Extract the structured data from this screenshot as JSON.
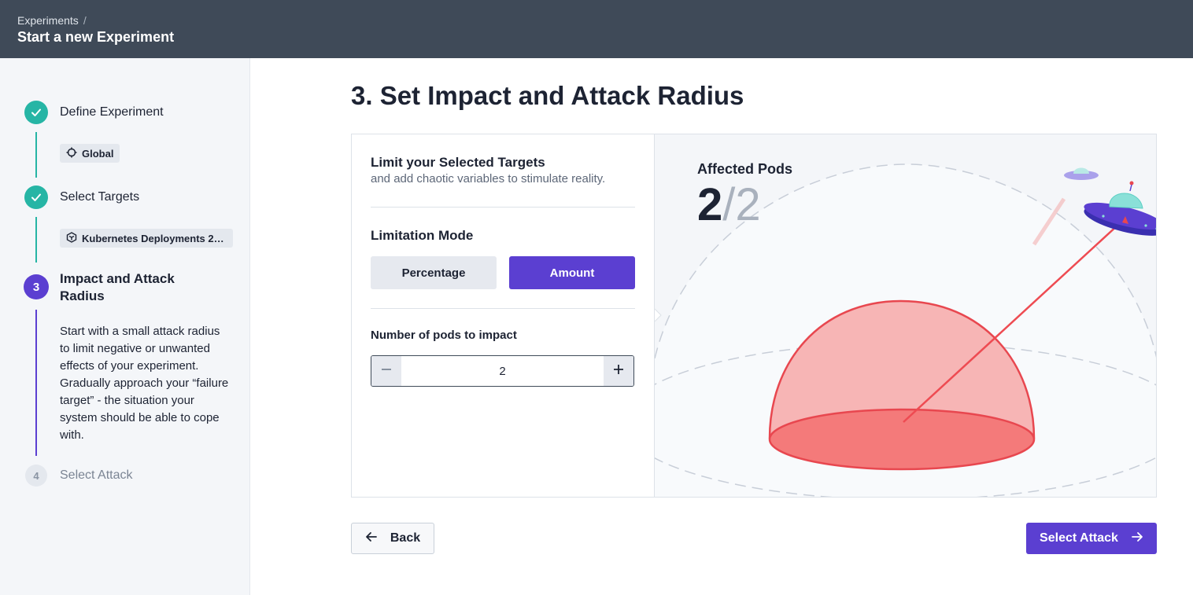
{
  "header": {
    "breadcrumb": "Experiments",
    "breadcrumb_separator": "/",
    "title": "Start a new Experiment"
  },
  "sidebar": {
    "steps": [
      {
        "label": "Define Experiment",
        "state": "done",
        "chip": "Global",
        "chip_icon": "crosshair-icon"
      },
      {
        "label": "Select Targets",
        "state": "done",
        "chip": "Kubernetes Deployments 2…",
        "chip_icon": "hexagon-box-icon"
      },
      {
        "number": "3",
        "label": "Impact and Attack Radius",
        "state": "active",
        "description": "Start with a small attack radius to limit negative or unwanted effects of your experiment. Gradually approach your “failure target” - the situation your system should be able to cope with."
      },
      {
        "number": "4",
        "label": "Select Attack",
        "state": "todo"
      }
    ]
  },
  "main": {
    "title": "3. Set Impact and Attack Radius",
    "limit": {
      "title": "Limit your Selected Targets",
      "subtitle": "and add chaotic variables to stimulate reality."
    },
    "limitation_mode": {
      "label": "Limitation Mode",
      "options": [
        "Percentage",
        "Amount"
      ],
      "selected": "Amount"
    },
    "pods": {
      "label": "Number of pods to impact",
      "value": "2"
    },
    "affected": {
      "label": "Affected Pods",
      "count": "2",
      "separator": "/",
      "total": "2"
    }
  },
  "footer": {
    "back_label": "Back",
    "next_label": "Select Attack"
  },
  "colors": {
    "header_bg": "#3f4a58",
    "accent": "#5b3fd1",
    "done": "#26b5a5",
    "dome": "#f47a7a"
  }
}
